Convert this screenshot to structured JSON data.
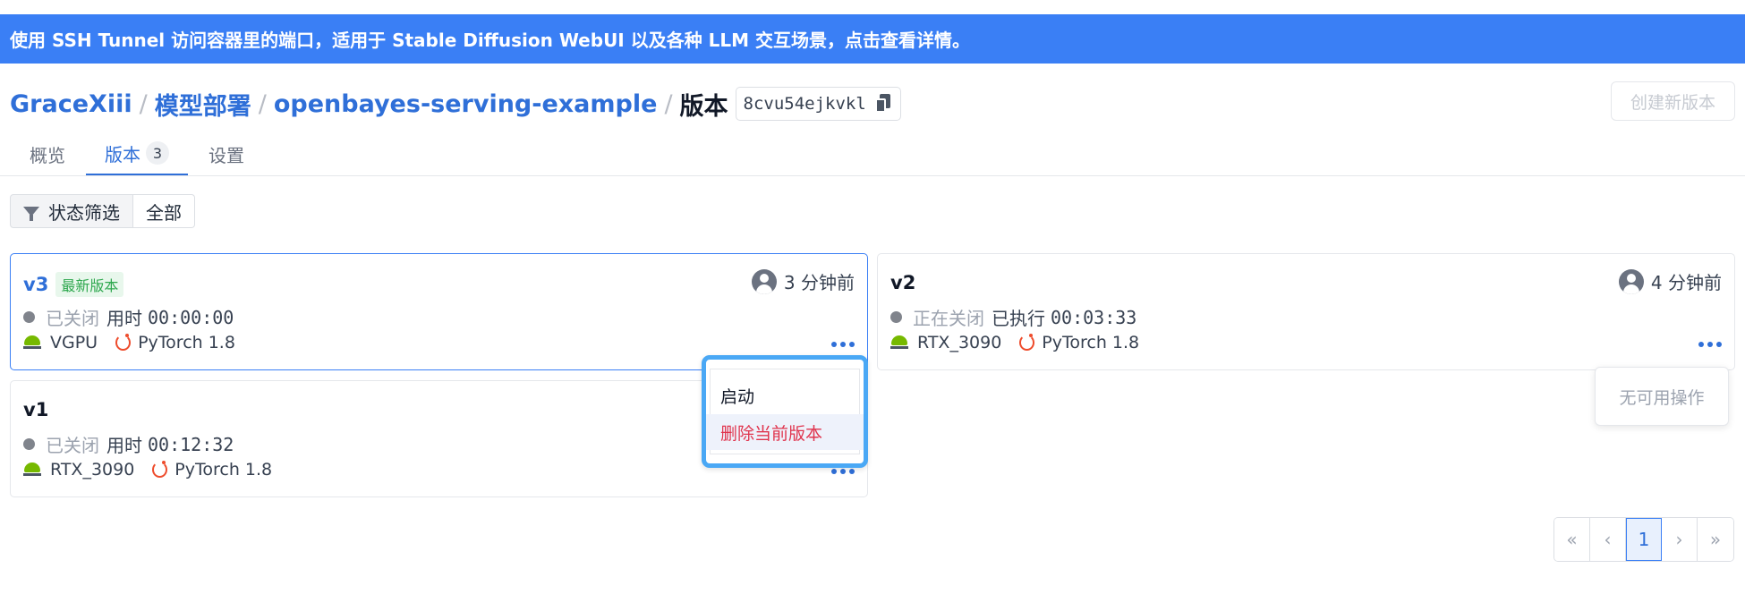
{
  "banner": {
    "text": "使用 SSH Tunnel 访问容器里的端口，适用于 Stable Diffusion WebUI 以及各种 LLM 交互场景，点击查看详情。"
  },
  "breadcrumb": {
    "user": "GraceXiii",
    "section": "模型部署",
    "project": "openbayes-serving-example",
    "current": "版本",
    "version_id": "8cvu54ejkvkl",
    "separator": "/"
  },
  "actions": {
    "create_version": "创建新版本"
  },
  "tabs": [
    {
      "label": "概览"
    },
    {
      "label": "版本",
      "badge": "3"
    },
    {
      "label": "设置"
    }
  ],
  "filter": {
    "label": "状态筛选",
    "value": "全部"
  },
  "cards": [
    {
      "name": "v3",
      "badge": "最新版本",
      "time": "3 分钟前",
      "status": "已关闭",
      "duration_label": "用时",
      "duration": "00:00:00",
      "gpu": "VGPU",
      "framework": "PyTorch 1.8"
    },
    {
      "name": "v2",
      "time": "4 分钟前",
      "status": "正在关闭",
      "duration_label": "已执行",
      "duration": "00:03:33",
      "gpu": "RTX_3090",
      "framework": "PyTorch 1.8"
    },
    {
      "name": "v1",
      "status": "已关闭",
      "duration_label": "用时",
      "duration": "00:12:32",
      "gpu": "RTX_3090",
      "framework": "PyTorch 1.8"
    }
  ],
  "dropdown": {
    "start": "启动",
    "delete": "删除当前版本"
  },
  "no_actions": "无可用操作",
  "pagination": {
    "first": "«",
    "prev": "‹",
    "current": "1",
    "next": "›",
    "last": "»"
  },
  "colors": {
    "accent": "#3a7ff5",
    "link": "#2f6fd8",
    "danger": "#e0344d",
    "success": "#2fa84f"
  }
}
